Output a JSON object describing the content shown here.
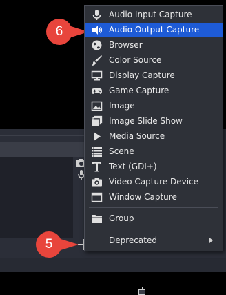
{
  "sources_menu": {
    "items": [
      {
        "label": "Audio Input Capture",
        "icon": "microphone-icon",
        "highlighted": false
      },
      {
        "label": "Audio Output Capture",
        "icon": "speaker-icon",
        "highlighted": true
      },
      {
        "label": "Browser",
        "icon": "globe-icon",
        "highlighted": false
      },
      {
        "label": "Color Source",
        "icon": "paint-brush-icon",
        "highlighted": false
      },
      {
        "label": "Display Capture",
        "icon": "monitor-icon",
        "highlighted": false
      },
      {
        "label": "Game Capture",
        "icon": "gamepad-icon",
        "highlighted": false
      },
      {
        "label": "Image",
        "icon": "image-icon",
        "highlighted": false
      },
      {
        "label": "Image Slide Show",
        "icon": "slideshow-icon",
        "highlighted": false
      },
      {
        "label": "Media Source",
        "icon": "play-icon",
        "highlighted": false
      },
      {
        "label": "Scene",
        "icon": "list-icon",
        "highlighted": false
      },
      {
        "label": "Text (GDI+)",
        "icon": "text-icon",
        "highlighted": false
      },
      {
        "label": "Video Capture Device",
        "icon": "camera-icon",
        "highlighted": false
      },
      {
        "label": "Window Capture",
        "icon": "window-icon",
        "highlighted": false
      }
    ],
    "group_label": "Group",
    "deprecated_label": "Deprecated"
  },
  "callouts": {
    "step_menu": "6",
    "step_add": "5",
    "color": "#e8453c"
  },
  "colors": {
    "highlight": "#1e5bd6",
    "menu_bg": "#2e3138"
  }
}
